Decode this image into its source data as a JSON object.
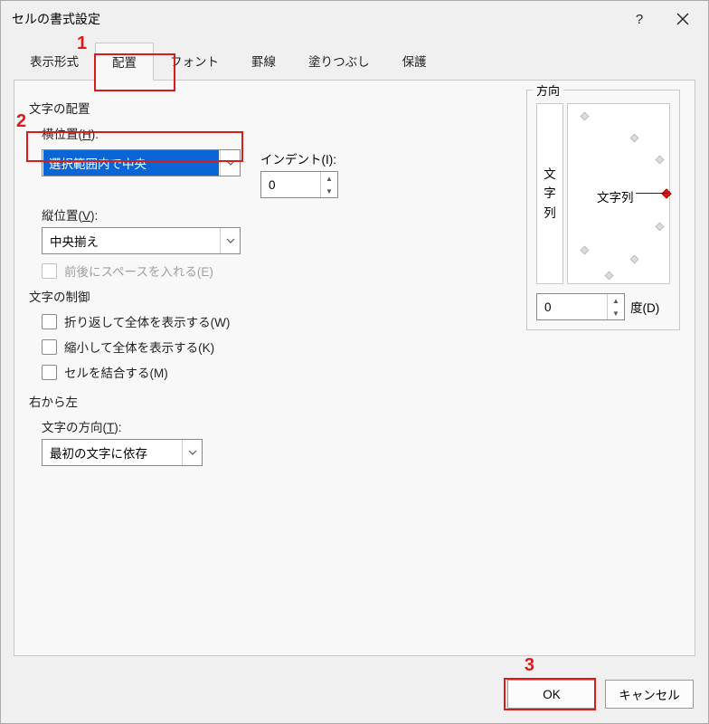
{
  "window": {
    "title": "セルの書式設定"
  },
  "tabs": [
    "表示形式",
    "配置",
    "フォント",
    "罫線",
    "塗りつぶし",
    "保護"
  ],
  "active_tab": 1,
  "alignment": {
    "group_label": "文字の配置",
    "horizontal_label_pre": "横位置(",
    "horizontal_label_key": "H",
    "horizontal_label_post": "):",
    "horizontal_value": "選択範囲内で中央",
    "vertical_label_pre": "縦位置(",
    "vertical_label_key": "V",
    "vertical_label_post": "):",
    "vertical_value": "中央揃え",
    "indent_label_pre": "インデント(",
    "indent_label_key": "I",
    "indent_label_post": "):",
    "indent_value": "0",
    "space_checkbox": "前後にスペースを入れる(E)"
  },
  "control": {
    "group_label": "文字の制御",
    "wrap_pre": "折り返して全体を表示する(",
    "wrap_key": "W",
    "wrap_post": ")",
    "shrink_pre": "縮小して全体を表示する(",
    "shrink_key": "K",
    "shrink_post": ")",
    "merge_pre": "セルを結合する(",
    "merge_key": "M",
    "merge_post": ")"
  },
  "rtl": {
    "group_label": "右から左",
    "direction_label_pre": "文字の方向(",
    "direction_label_key": "T",
    "direction_label_post": "):",
    "direction_value": "最初の文字に依存"
  },
  "orientation": {
    "group_label": "方向",
    "vertical_text_1": "文",
    "vertical_text_2": "字",
    "vertical_text_3": "列",
    "dial_text": "文字列",
    "degree_value": "0",
    "degree_label_pre": "度(",
    "degree_label_key": "D",
    "degree_label_post": ")"
  },
  "buttons": {
    "ok": "OK",
    "cancel": "キャンセル"
  },
  "annotations": {
    "n1": "1",
    "n2": "2",
    "n3": "3"
  }
}
